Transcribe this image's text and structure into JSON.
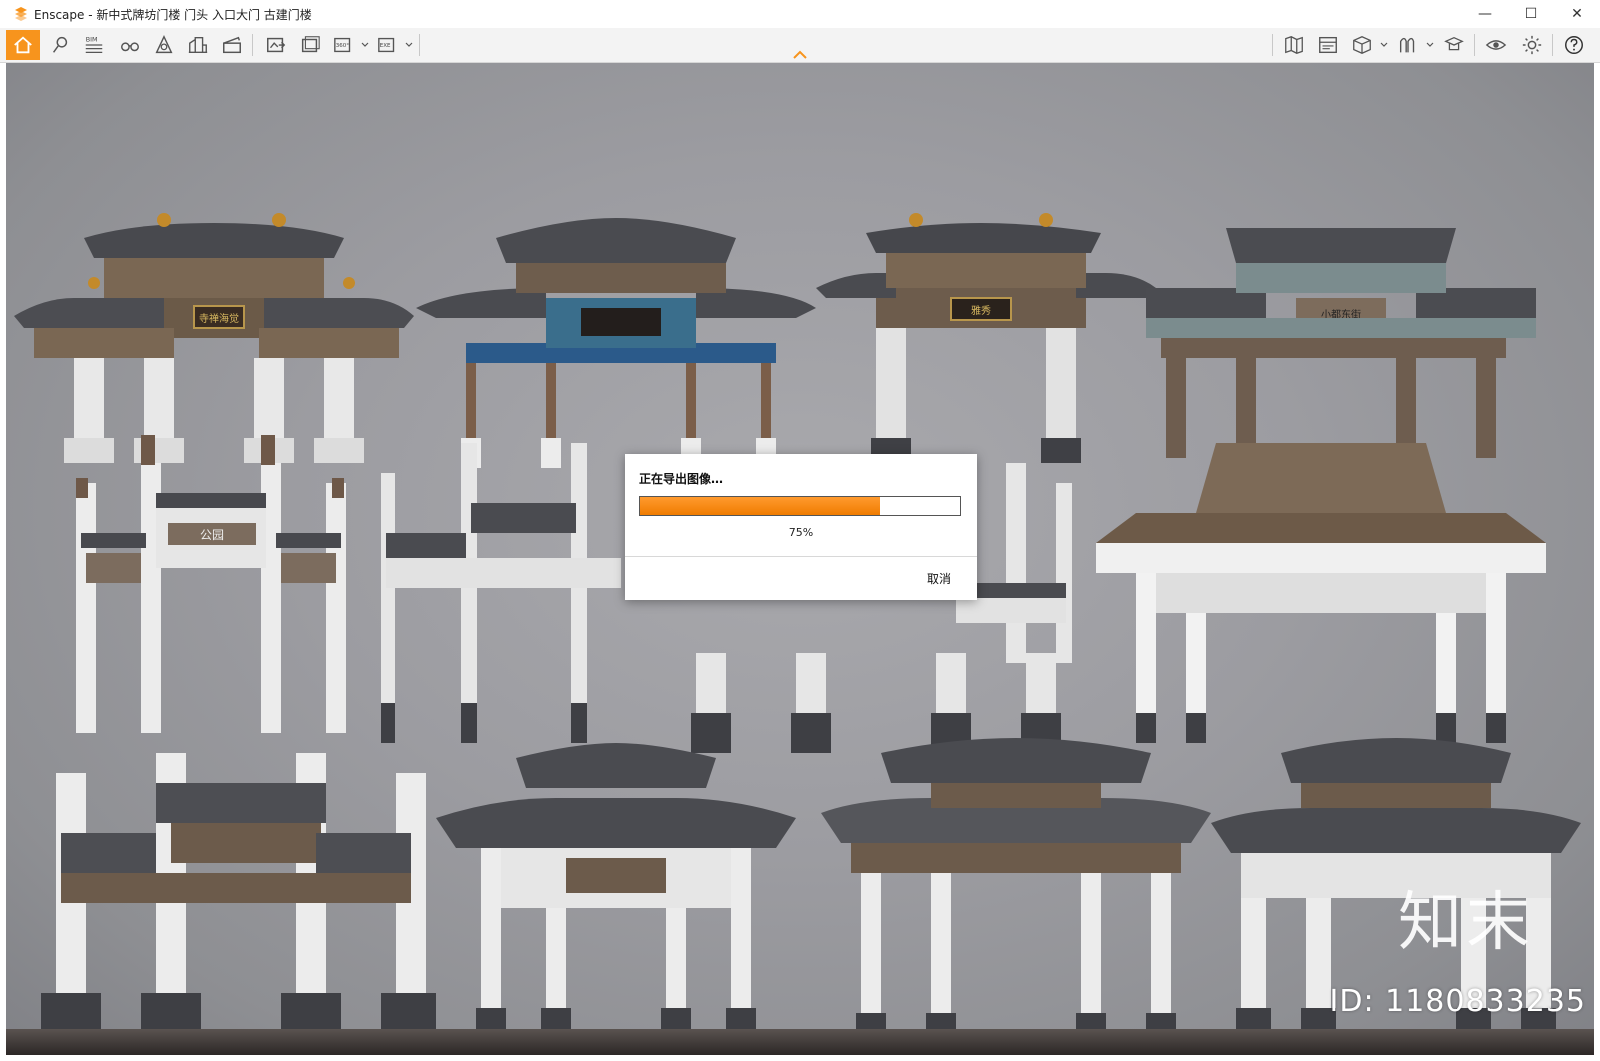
{
  "window": {
    "app_name": "Enscape",
    "title": "Enscape - 新中式牌坊门楼 门头 入口大门 古建门楼",
    "controls": {
      "minimize": "—",
      "maximize": "☐",
      "close": "✕"
    }
  },
  "toolbar": {
    "left_items": [
      {
        "name": "home-icon"
      },
      {
        "name": "location-pin-icon"
      },
      {
        "name": "bim-icon",
        "label": "BIM"
      },
      {
        "name": "binoculars-icon"
      },
      {
        "name": "atmosphere-icon"
      },
      {
        "name": "buildings-icon"
      },
      {
        "name": "clapperboard-icon"
      },
      {
        "name": "screenshot-icon"
      },
      {
        "name": "batch-render-icon"
      },
      {
        "name": "panorama-icon",
        "label": "360°"
      },
      {
        "name": "export-exe-icon",
        "label": "EXE"
      }
    ],
    "right_items": [
      {
        "name": "map-icon"
      },
      {
        "name": "video-editor-icon"
      },
      {
        "name": "cube-icon"
      },
      {
        "name": "asset-library-icon"
      },
      {
        "name": "cap-icon"
      },
      {
        "name": "eye-icon"
      },
      {
        "name": "settings-icon"
      },
      {
        "name": "help-icon"
      }
    ]
  },
  "viewport": {
    "watermark_logo": "知末",
    "watermark_id": "ID: 1180833235",
    "signboards": [
      "寺禅海觉",
      "雅秀",
      "小都东街",
      "公园"
    ]
  },
  "export_dialog": {
    "title": "正在导出图像…",
    "progress_percent": 75,
    "progress_label": "75%",
    "cancel_label": "取消"
  },
  "colors": {
    "accent": "#f7941d",
    "progress": "#f07c00",
    "toolbar_bg": "#f3f3f3"
  }
}
